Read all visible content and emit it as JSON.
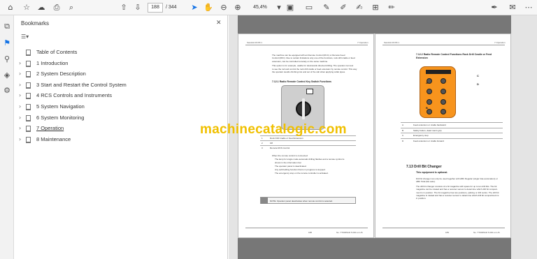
{
  "toolbar": {
    "current_page": "188",
    "total_pages": "/ 344",
    "zoom": "45,4%"
  },
  "panel": {
    "title": "Bookmarks",
    "bookmarks": [
      {
        "label": "Table of Contents",
        "expandable": false
      },
      {
        "label": "1 Introduction",
        "expandable": true
      },
      {
        "label": "2 System Description",
        "expandable": true
      },
      {
        "label": "3 Start and Restart the Control System",
        "expandable": true
      },
      {
        "label": "4 RCS Controls and Instruments",
        "expandable": true
      },
      {
        "label": "5 System Navigation",
        "expandable": true
      },
      {
        "label": "6 System Monitoring",
        "expandable": true
      },
      {
        "label": "7 Operation",
        "expandable": true,
        "active": true
      },
      {
        "label": "8 Maintenance",
        "expandable": true
      }
    ]
  },
  "doc": {
    "left_page": {
      "header_left": "Sandvik RCS5 1",
      "header_right": "7 Operation",
      "intro": [
        "The machine can be equipped with an Remote Control (RCC) or Remote Feed",
        "Control (RFC). Due to certain limitations only one of the functions, rock drill cradle or feed",
        "extension, can be controlled remotely on the same machine.",
        "This option is for example, usable for downwards directed drilling. The operator can test",
        "to see the rod and control the rock drill cradle or feed extension by remote control. This way",
        "the operator avoids climbing into and out of the cab when applying collar pipes."
      ],
      "subhead": "7.12.1  Radio Remote Control Key Switch Functions",
      "table_rows": [
        "Rock Drill Cradle or Feed Extension",
        "Off",
        "Remote RCS Control"
      ],
      "table_keys": [
        "1",
        "2",
        "3"
      ],
      "after_table": [
        "When the remote control is connected:",
        "The lamp for single mode automatic drilling flashes and a remote symbol is",
        "shown in the information bar.",
        "The operator panel is deactivated.",
        "Any self-holding function that is in progress is stopped.",
        "The emergency stop on the remote controller is activated."
      ],
      "note": "NOTE: Operator panel deactivates when remote control is selected.",
      "footer_page": "188",
      "footer_doc": "No. TT0065AD 5.000 en-US"
    },
    "right_page": {
      "header_left": "Sandvik RCS5 1",
      "header_right": "7 Operation",
      "subhead": "7.12.2  Radio Remote Control Functions Rock Drill Cradle or Feed Extension",
      "callouts": [
        "A",
        "B",
        "C",
        "D"
      ],
      "table_rows": [
        "Feed extension or cradle backward",
        "Safety button, dead man's grip",
        "Emergency stop",
        "Feed extension or cradle forward"
      ],
      "table_keys": [
        "A",
        "B",
        "C",
        "D"
      ],
      "section": "7.13  Drill Bit Changer",
      "section_sub": "This equipment is optional.",
      "section_text": [
        "Drill bit changer can only be used together with ABC Regular (single hole automation) or",
        "ABC Total (fan auto).",
        "The drill bit changer consists of a bit magazine with space for up to ten drill bits. The bit",
        "magazine can be rotated and has a receiver sensor to determine which drill bit compart-",
        "ment is in position. The bit magazine has two positions, parking or drill centre. The drill bit",
        "magazine is rotated and has a receiver sensor to determine which drill bit compartment is",
        "in position."
      ],
      "footer_page": "189",
      "footer_doc": "No. TT0065AD 5.000 en-US"
    }
  },
  "watermark": "machinecatalogic.com",
  "colors": {
    "accent": "#1473e6",
    "watermark": "#f0c000",
    "remote": "#f7941d"
  }
}
